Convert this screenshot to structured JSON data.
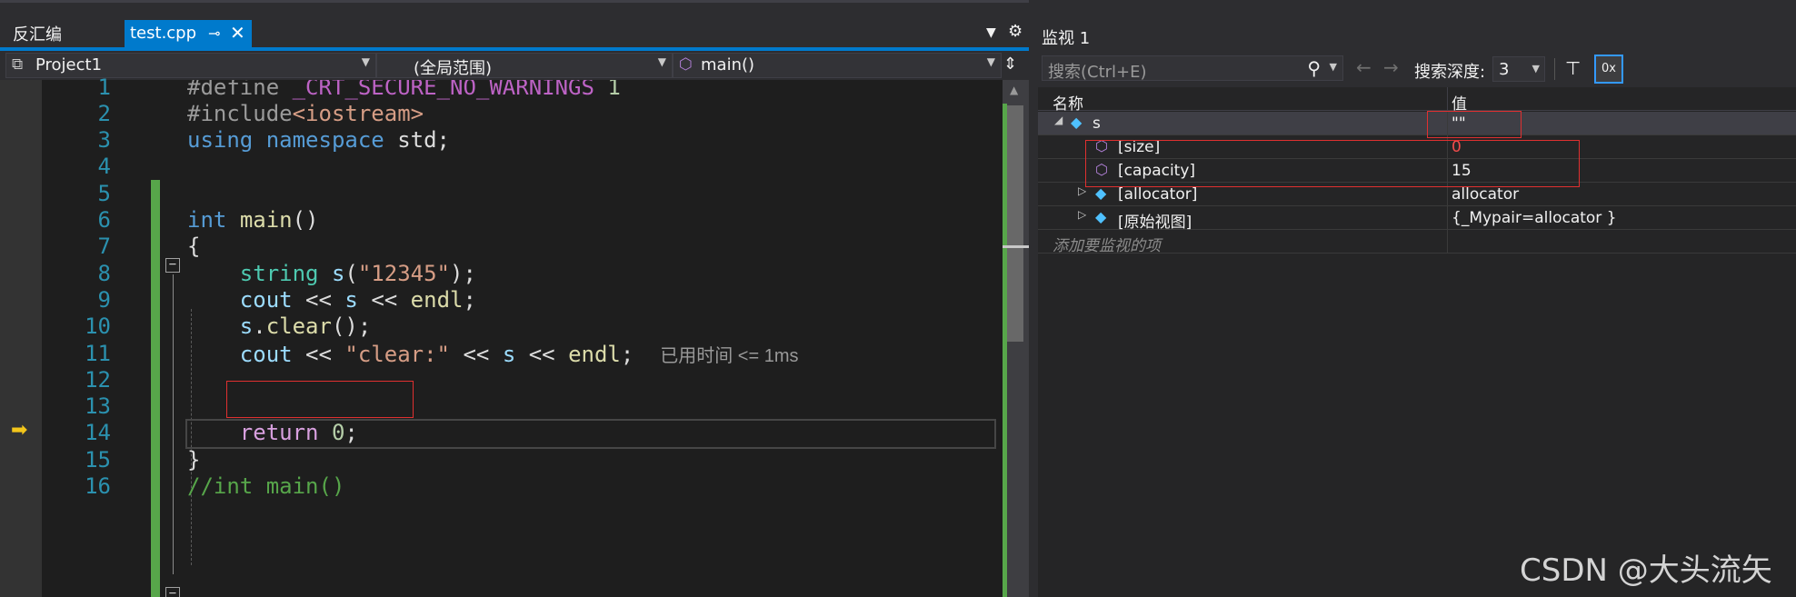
{
  "tabs": {
    "inactive": "反汇编",
    "active": "test.cpp",
    "pin_glyph": "⊸",
    "close_glyph": "✕"
  },
  "navbar": {
    "project": "Project1",
    "scope": "(全局范围)",
    "function": "main()"
  },
  "line_numbers": [
    "1",
    "2",
    "3",
    "4",
    "5",
    "6",
    "7",
    "8",
    "9",
    "10",
    "11",
    "12",
    "13",
    "14",
    "15",
    "16"
  ],
  "code": {
    "l1": {
      "pp": "#define",
      "mac": "_CRT_SECURE_NO_WARNINGS",
      "num": "1"
    },
    "l2": {
      "pp": "#include",
      "str": "<iostream>"
    },
    "l3": {
      "kw1": "using",
      "kw2": "namespace",
      "txt": "std;"
    },
    "l6": {
      "kw": "int",
      "fn": "main",
      "txt": "()"
    },
    "l7": {
      "txt": "{"
    },
    "l8": {
      "ty": "string",
      "var": "s",
      "p1": "(",
      "str": "\"12345\"",
      "p2": ");"
    },
    "l9": {
      "var1": "cout",
      "op": "<<",
      "var2": "s",
      "op2": "<<",
      "fn": "endl",
      "end": ";"
    },
    "l10": {
      "var": "s",
      "dot": ".",
      "fn": "clear",
      "end": "();"
    },
    "l11": {
      "var1": "cout",
      "op": "<<",
      "str": "\"clear:\"",
      "op2": "<<",
      "var2": "s",
      "op3": "<<",
      "fn": "endl",
      "end": ";",
      "perf": "已用时间 <= 1ms"
    },
    "l14": {
      "ctl": "return",
      "num": "0",
      "end": ";"
    },
    "l15": {
      "txt": "}"
    },
    "l16": {
      "txt": "//int main()"
    }
  },
  "watch": {
    "title": "监视 1",
    "search_placeholder": "搜索(Ctrl+E)",
    "depth_label": "搜索深度:",
    "depth_value": "3",
    "hex_label": "0x",
    "col_name": "名称",
    "col_value": "值",
    "rows": [
      {
        "name": "s",
        "value": "\"\"",
        "expand": "◢",
        "icon": "cube-icon"
      },
      {
        "name": "[size]",
        "value": "0",
        "changed": true,
        "icon": "field-icon"
      },
      {
        "name": "[capacity]",
        "value": "15",
        "icon": "field-icon"
      },
      {
        "name": "[allocator]",
        "value": "allocator",
        "expand": "▷",
        "icon": "cube-icon"
      },
      {
        "name": "[原始视图]",
        "value": "{_Mypair=allocator }",
        "expand": "▷",
        "icon": "cube-icon"
      }
    ],
    "add_item": "添加要监视的项"
  },
  "watermark": "CSDN @大头流矢"
}
